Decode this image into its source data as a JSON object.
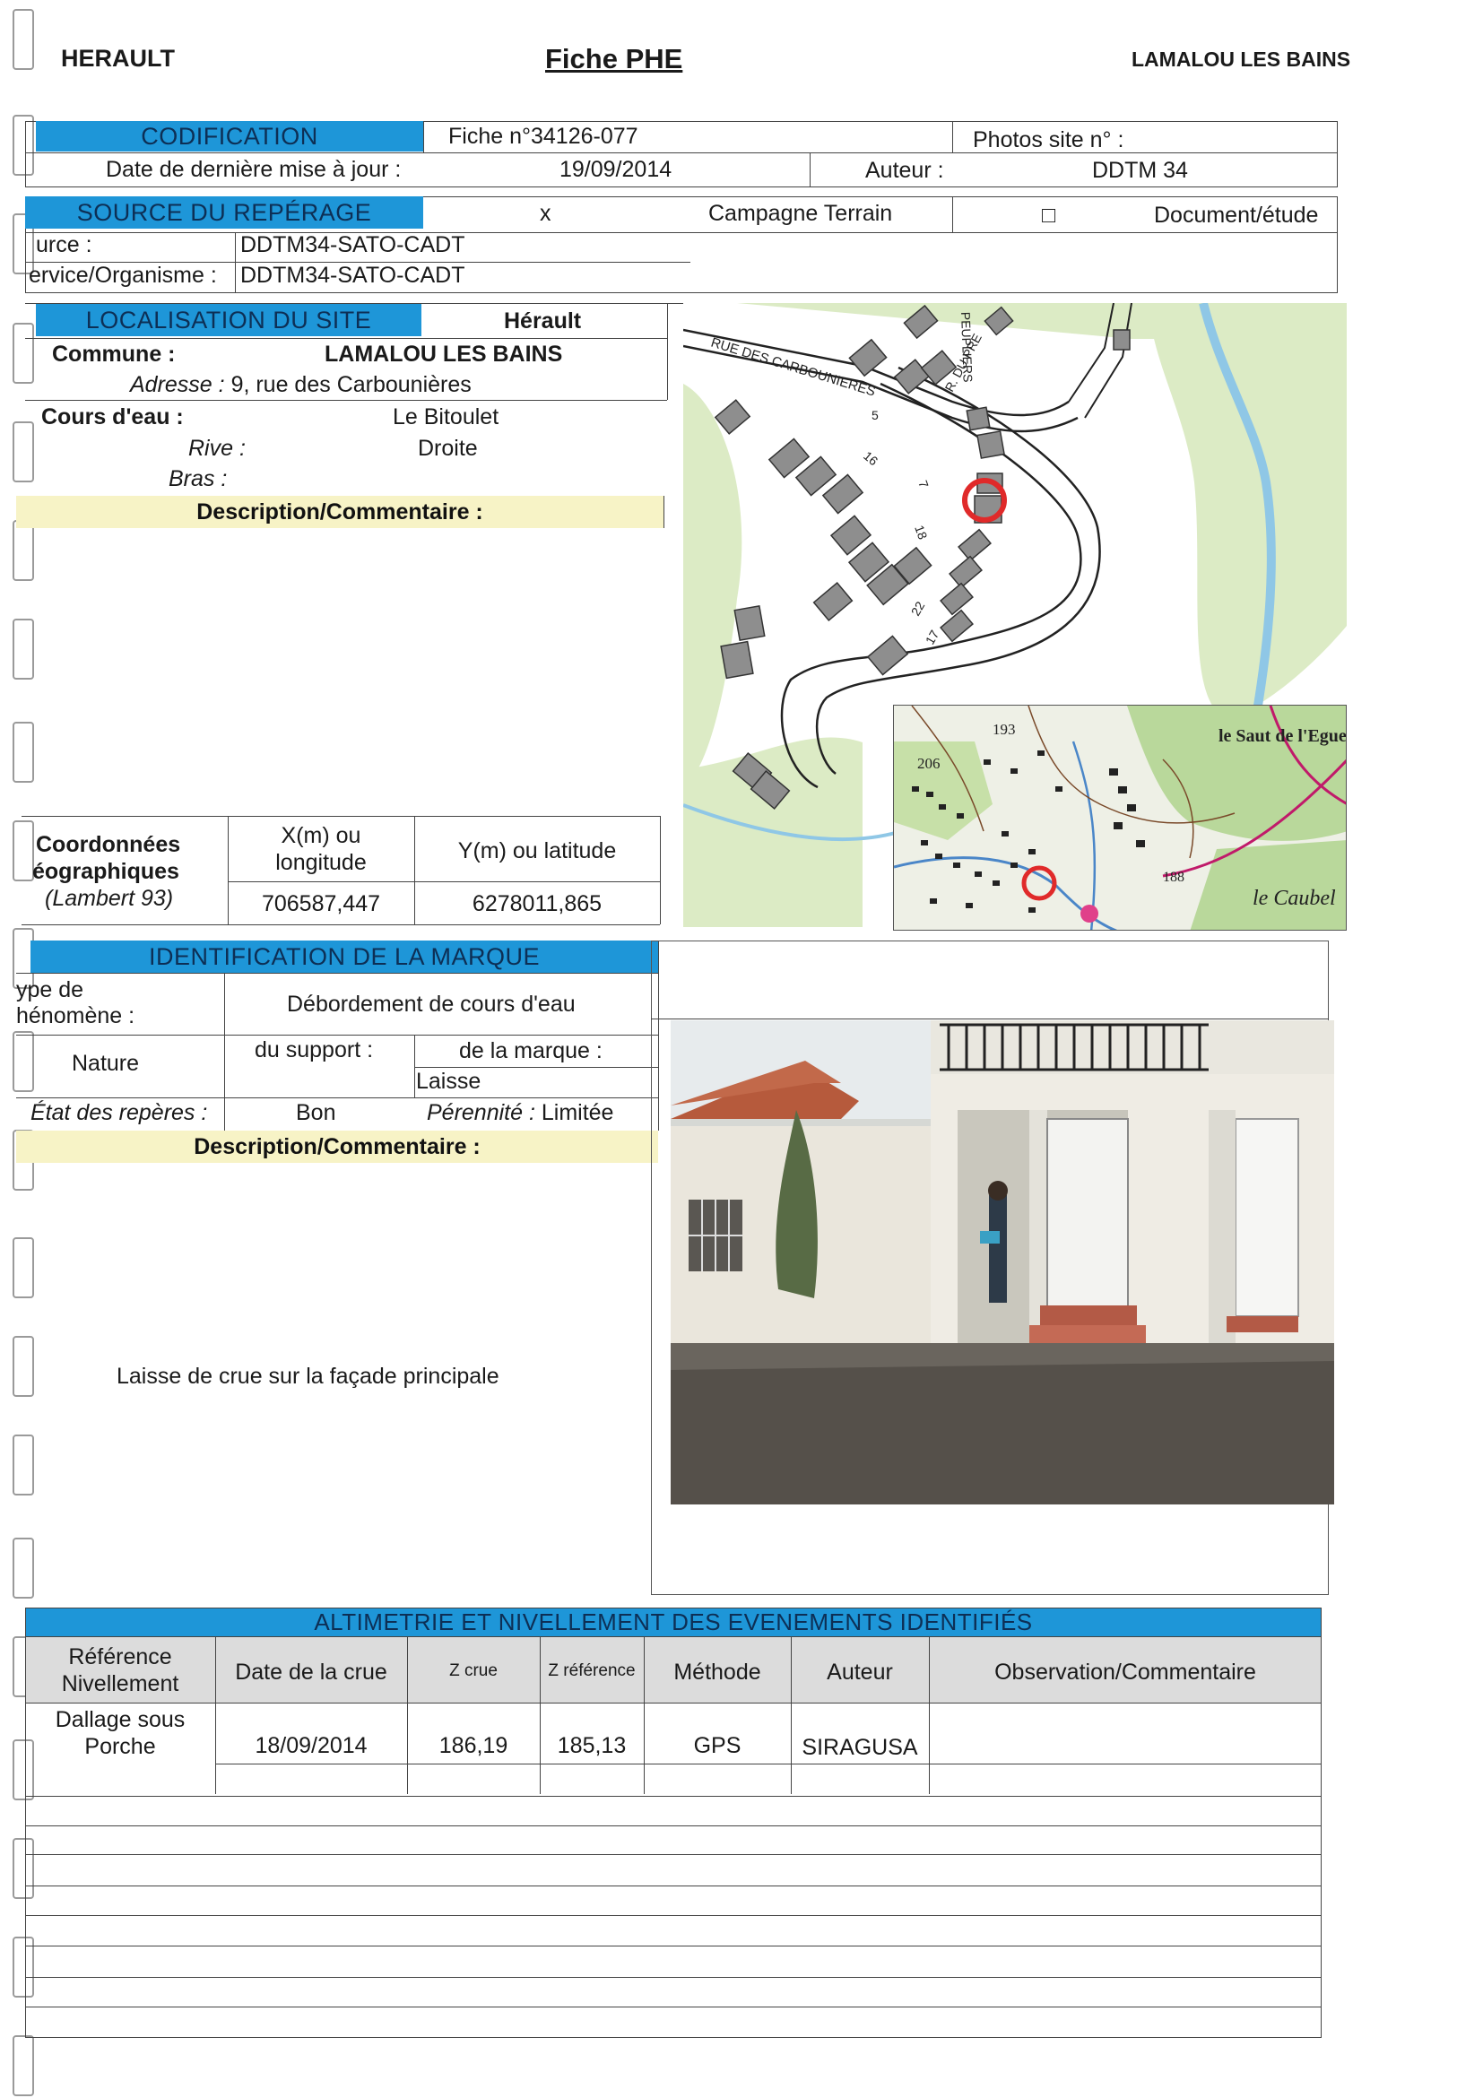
{
  "header": {
    "departement": "HERAULT",
    "title": "Fiche PHE",
    "commune": "LAMALOU LES BAINS"
  },
  "codification": {
    "heading": "CODIFICATION",
    "fiche": "Fiche n°34126-077",
    "photos_label": "Photos site n° :",
    "date_label": "Date de dernière mise à jour :",
    "date_value": "19/09/2014",
    "auteur_label": "Auteur :",
    "auteur_value": "DDTM 34"
  },
  "source": {
    "heading": "SOURCE DU REPÉRAGE",
    "mark_x": "x",
    "campagne": "Campagne Terrain",
    "checkbox": "□",
    "document": "Document/étude",
    "source_label": "urce :",
    "source_value": "DDTM34-SATO-CADT",
    "service_label": "ervice/Organisme :",
    "service_value": "DDTM34-SATO-CADT"
  },
  "localisation": {
    "heading": "LOCALISATION DU SITE",
    "region": "Hérault",
    "commune_label": "Commune :",
    "commune_value": "LAMALOU LES BAINS",
    "adresse_label": "Adresse :",
    "adresse_value": "9, rue des Carbounières",
    "cours_label": "Cours d'eau :",
    "cours_value": "Le Bitoulet",
    "rive_label": "Rive :",
    "rive_value": "Droite",
    "bras_label": "Bras :",
    "description_label": "Description/Commentaire :"
  },
  "coords": {
    "label1": "Coordonnées",
    "label2": "éographiques",
    "label3": "(Lambert 93)",
    "x_header1": "X(m) ou",
    "x_header2": "longitude",
    "y_header": "Y(m) ou latitude",
    "x_value": "706587,447",
    "y_value": "6278011,865"
  },
  "map": {
    "street_main": "RUE DES CARBOUNIERES",
    "street_pre": "R. DU PRE",
    "street_peupliers": "PEUPLIERS",
    "numbers": [
      "5",
      "16",
      "7",
      "18",
      "22",
      "17"
    ],
    "topo_labels": [
      "193",
      "206",
      "le Saut de l'Egue",
      "188",
      "le Caubel"
    ]
  },
  "identification": {
    "heading": "IDENTIFICATION DE LA MARQUE",
    "type_label1": "ype de",
    "type_label2": "hénomène :",
    "type_value": "Débordement de cours d'eau",
    "nature_label": "Nature",
    "support_label": "du support :",
    "marque_label": "de la marque :",
    "marque_value": "Laisse",
    "etat_label": "État des repères :",
    "etat_value": "Bon",
    "perennite_label": "Pérennité :",
    "perennite_value": "Limitée",
    "description_label": "Description/Commentaire :",
    "description_value": "Laisse de crue sur la façade principale"
  },
  "altimetrie": {
    "heading": "ALTIMETRIE ET NIVELLEMENT DES EVENEMENTS IDENTIFIÉS",
    "columns": [
      "Référence Nivellement",
      "Date de la crue",
      "Z crue",
      "Z référence",
      "Méthode",
      "Auteur",
      "Observation/Commentaire"
    ],
    "row": [
      "Dallage sous Porche",
      "18/09/2014",
      "186,19",
      "185,13",
      "GPS",
      "SIRAGUSA",
      ""
    ]
  },
  "colors": {
    "section_blue": "#1e96d8",
    "description_yellow": "#f7f3c6",
    "marker_red": "#e02a2a"
  }
}
